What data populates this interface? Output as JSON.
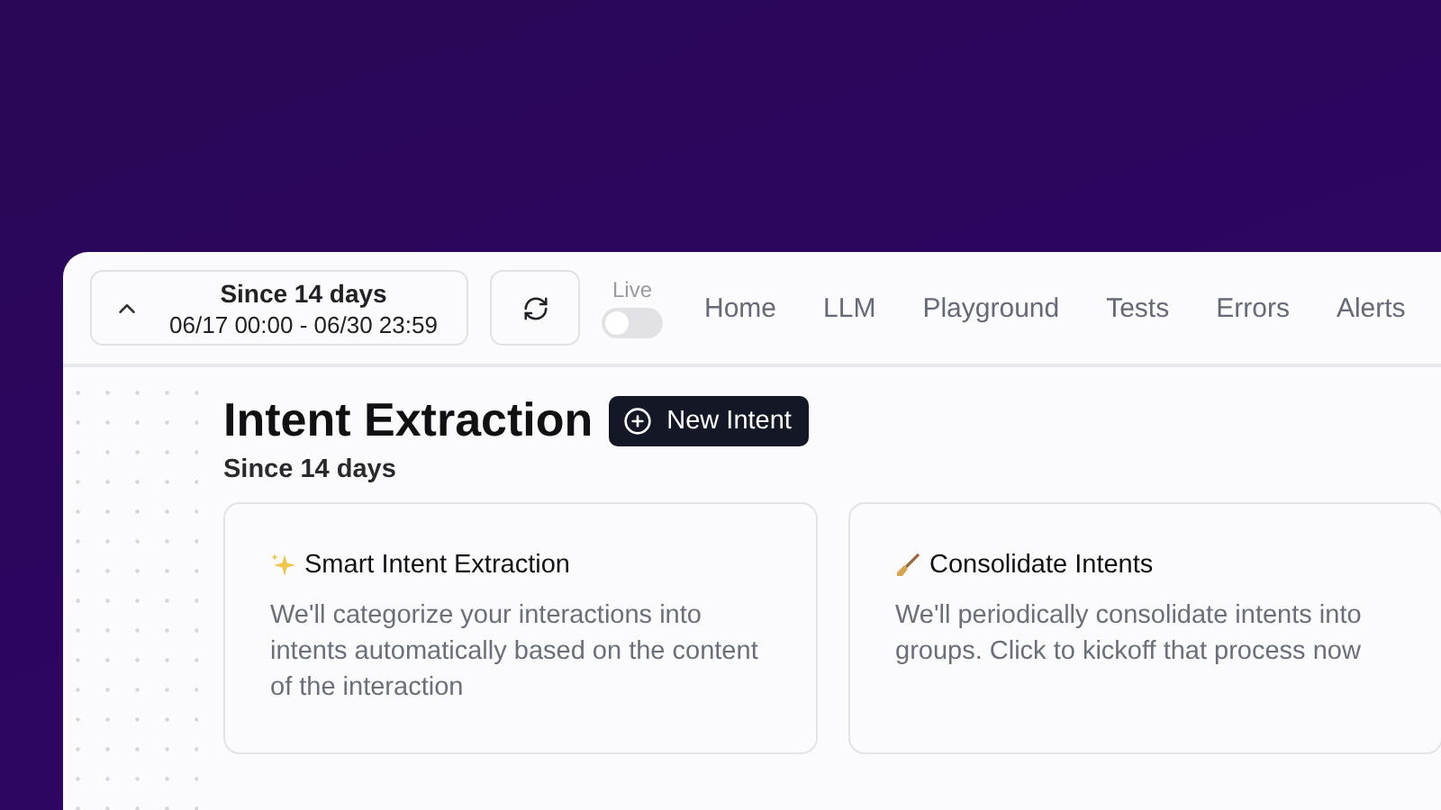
{
  "range": {
    "title": "Since 14 days",
    "dates": "06/17 00:00 - 06/30 23:59"
  },
  "live": {
    "label": "Live",
    "on": false
  },
  "nav": [
    "Home",
    "LLM",
    "Playground",
    "Tests",
    "Errors",
    "Alerts"
  ],
  "page": {
    "title": "Intent Extraction",
    "button": "New Intent",
    "subtitle": "Since 14 days"
  },
  "cards": [
    {
      "kind": "sparkle",
      "title": "Smart Intent Extraction",
      "text": "We'll categorize your interactions into intents automatically based on the content of the interaction"
    },
    {
      "kind": "broom",
      "title": "Consolidate Intents",
      "text": "We'll periodically consolidate intents into groups. Click to kickoff that process now"
    }
  ]
}
